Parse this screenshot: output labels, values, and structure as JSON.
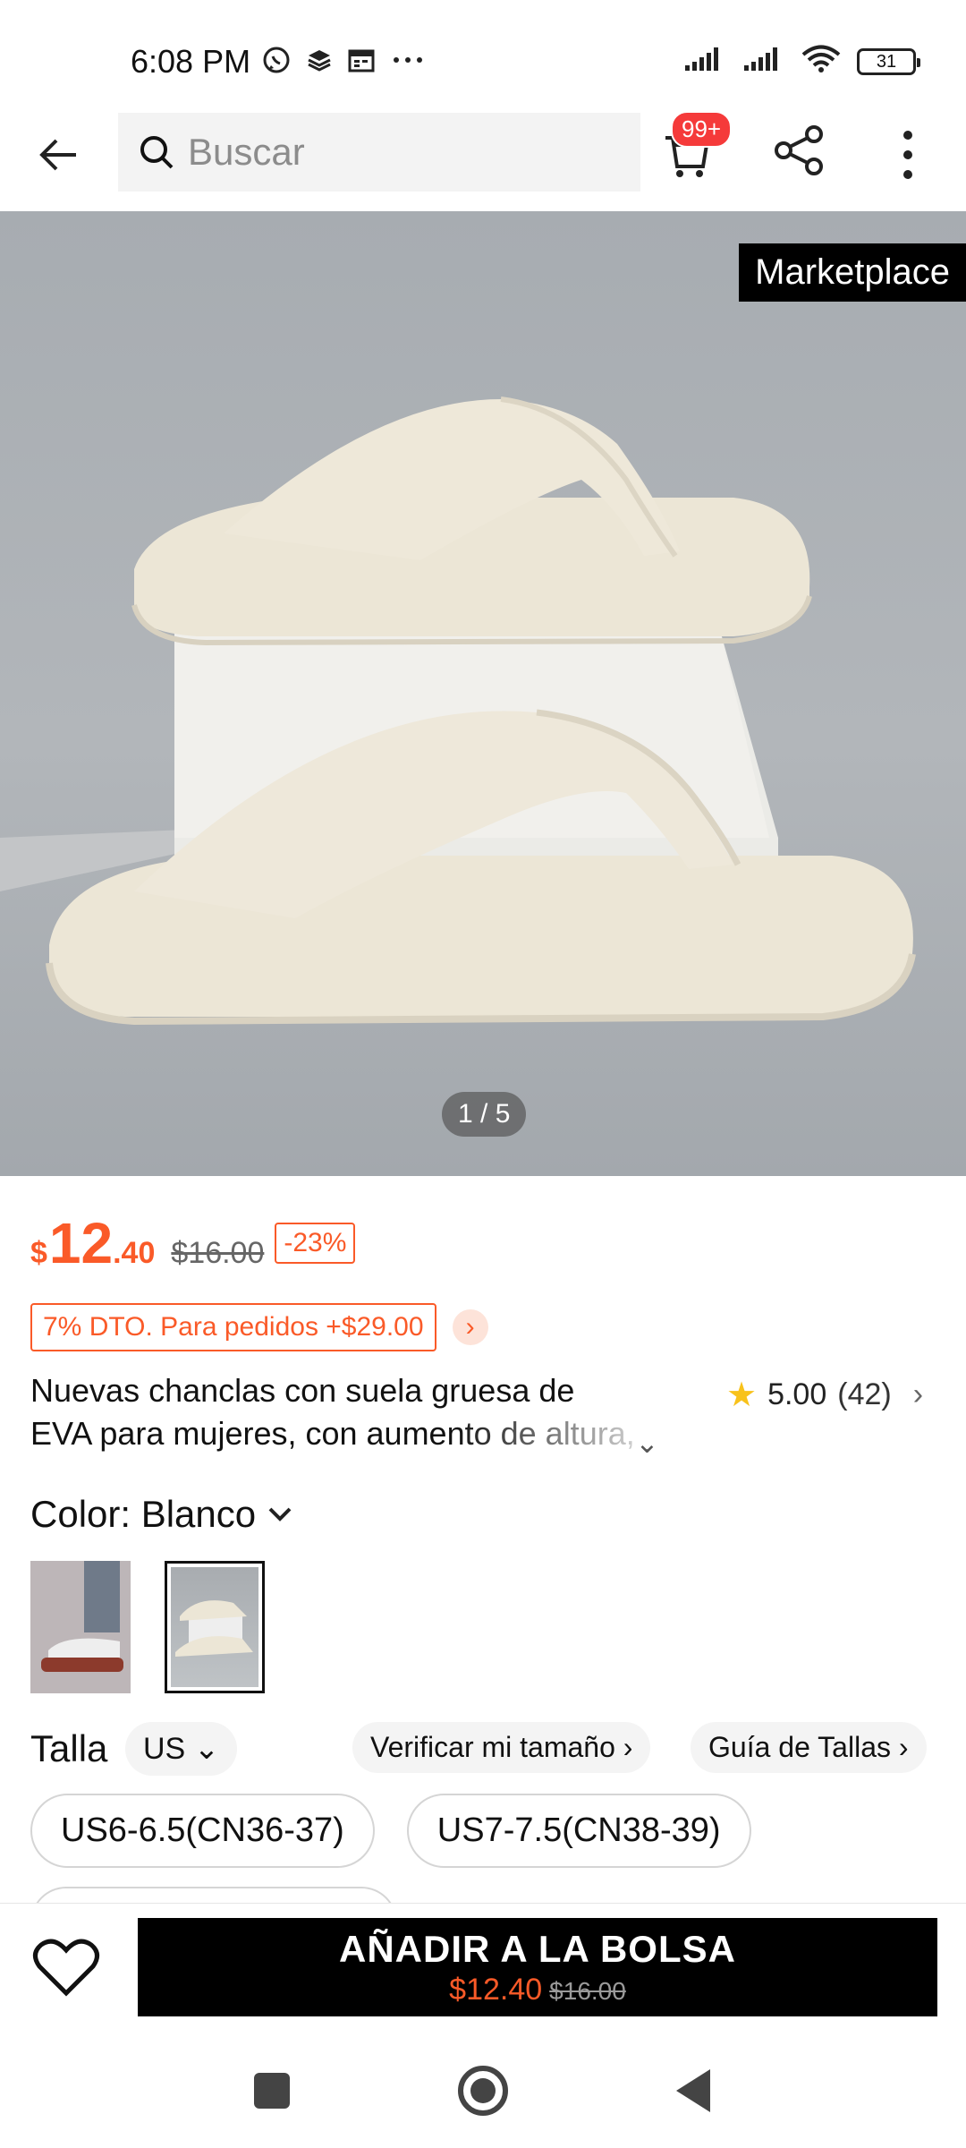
{
  "status_bar": {
    "time": "6:08 PM",
    "battery": "31",
    "icons_left": [
      "whatsapp-icon",
      "layers-icon",
      "calendar-icon",
      "more-dots-icon"
    ],
    "icons_right": [
      "signal-icon",
      "signal-icon",
      "wifi-icon",
      "battery-icon"
    ]
  },
  "header": {
    "search_placeholder": "Buscar",
    "cart_badge": "99+"
  },
  "gallery": {
    "marketplace_label": "Marketplace",
    "page_indicator": "1 / 5"
  },
  "price": {
    "currency": "$",
    "integer": "12",
    "decimal": ".40",
    "original": "$16.00",
    "discount": "-23%"
  },
  "promo": {
    "text": "7% DTO. Para pedidos +$29.00"
  },
  "product": {
    "title_line1": "Nuevas chanclas con suela gruesa de",
    "title_line2": "EVA para mujeres, con aumento de altura,"
  },
  "rating": {
    "score": "5.00",
    "count": "(42)"
  },
  "color": {
    "label": "Color: Blanco"
  },
  "size": {
    "label": "Talla",
    "unit": "US",
    "verify": "Verificar mi tamaño",
    "guide": "Guía de Tallas",
    "options": [
      "US6-6.5(CN36-37)",
      "US7-7.5(CN38-39)"
    ]
  },
  "action": {
    "add_label": "AÑADIR A LA BOLSA",
    "price": "$12.40",
    "original_price": "$16.00"
  },
  "colors": {
    "accent": "#fa5a28",
    "badge": "#f53a3a",
    "star": "#f8c21b"
  }
}
